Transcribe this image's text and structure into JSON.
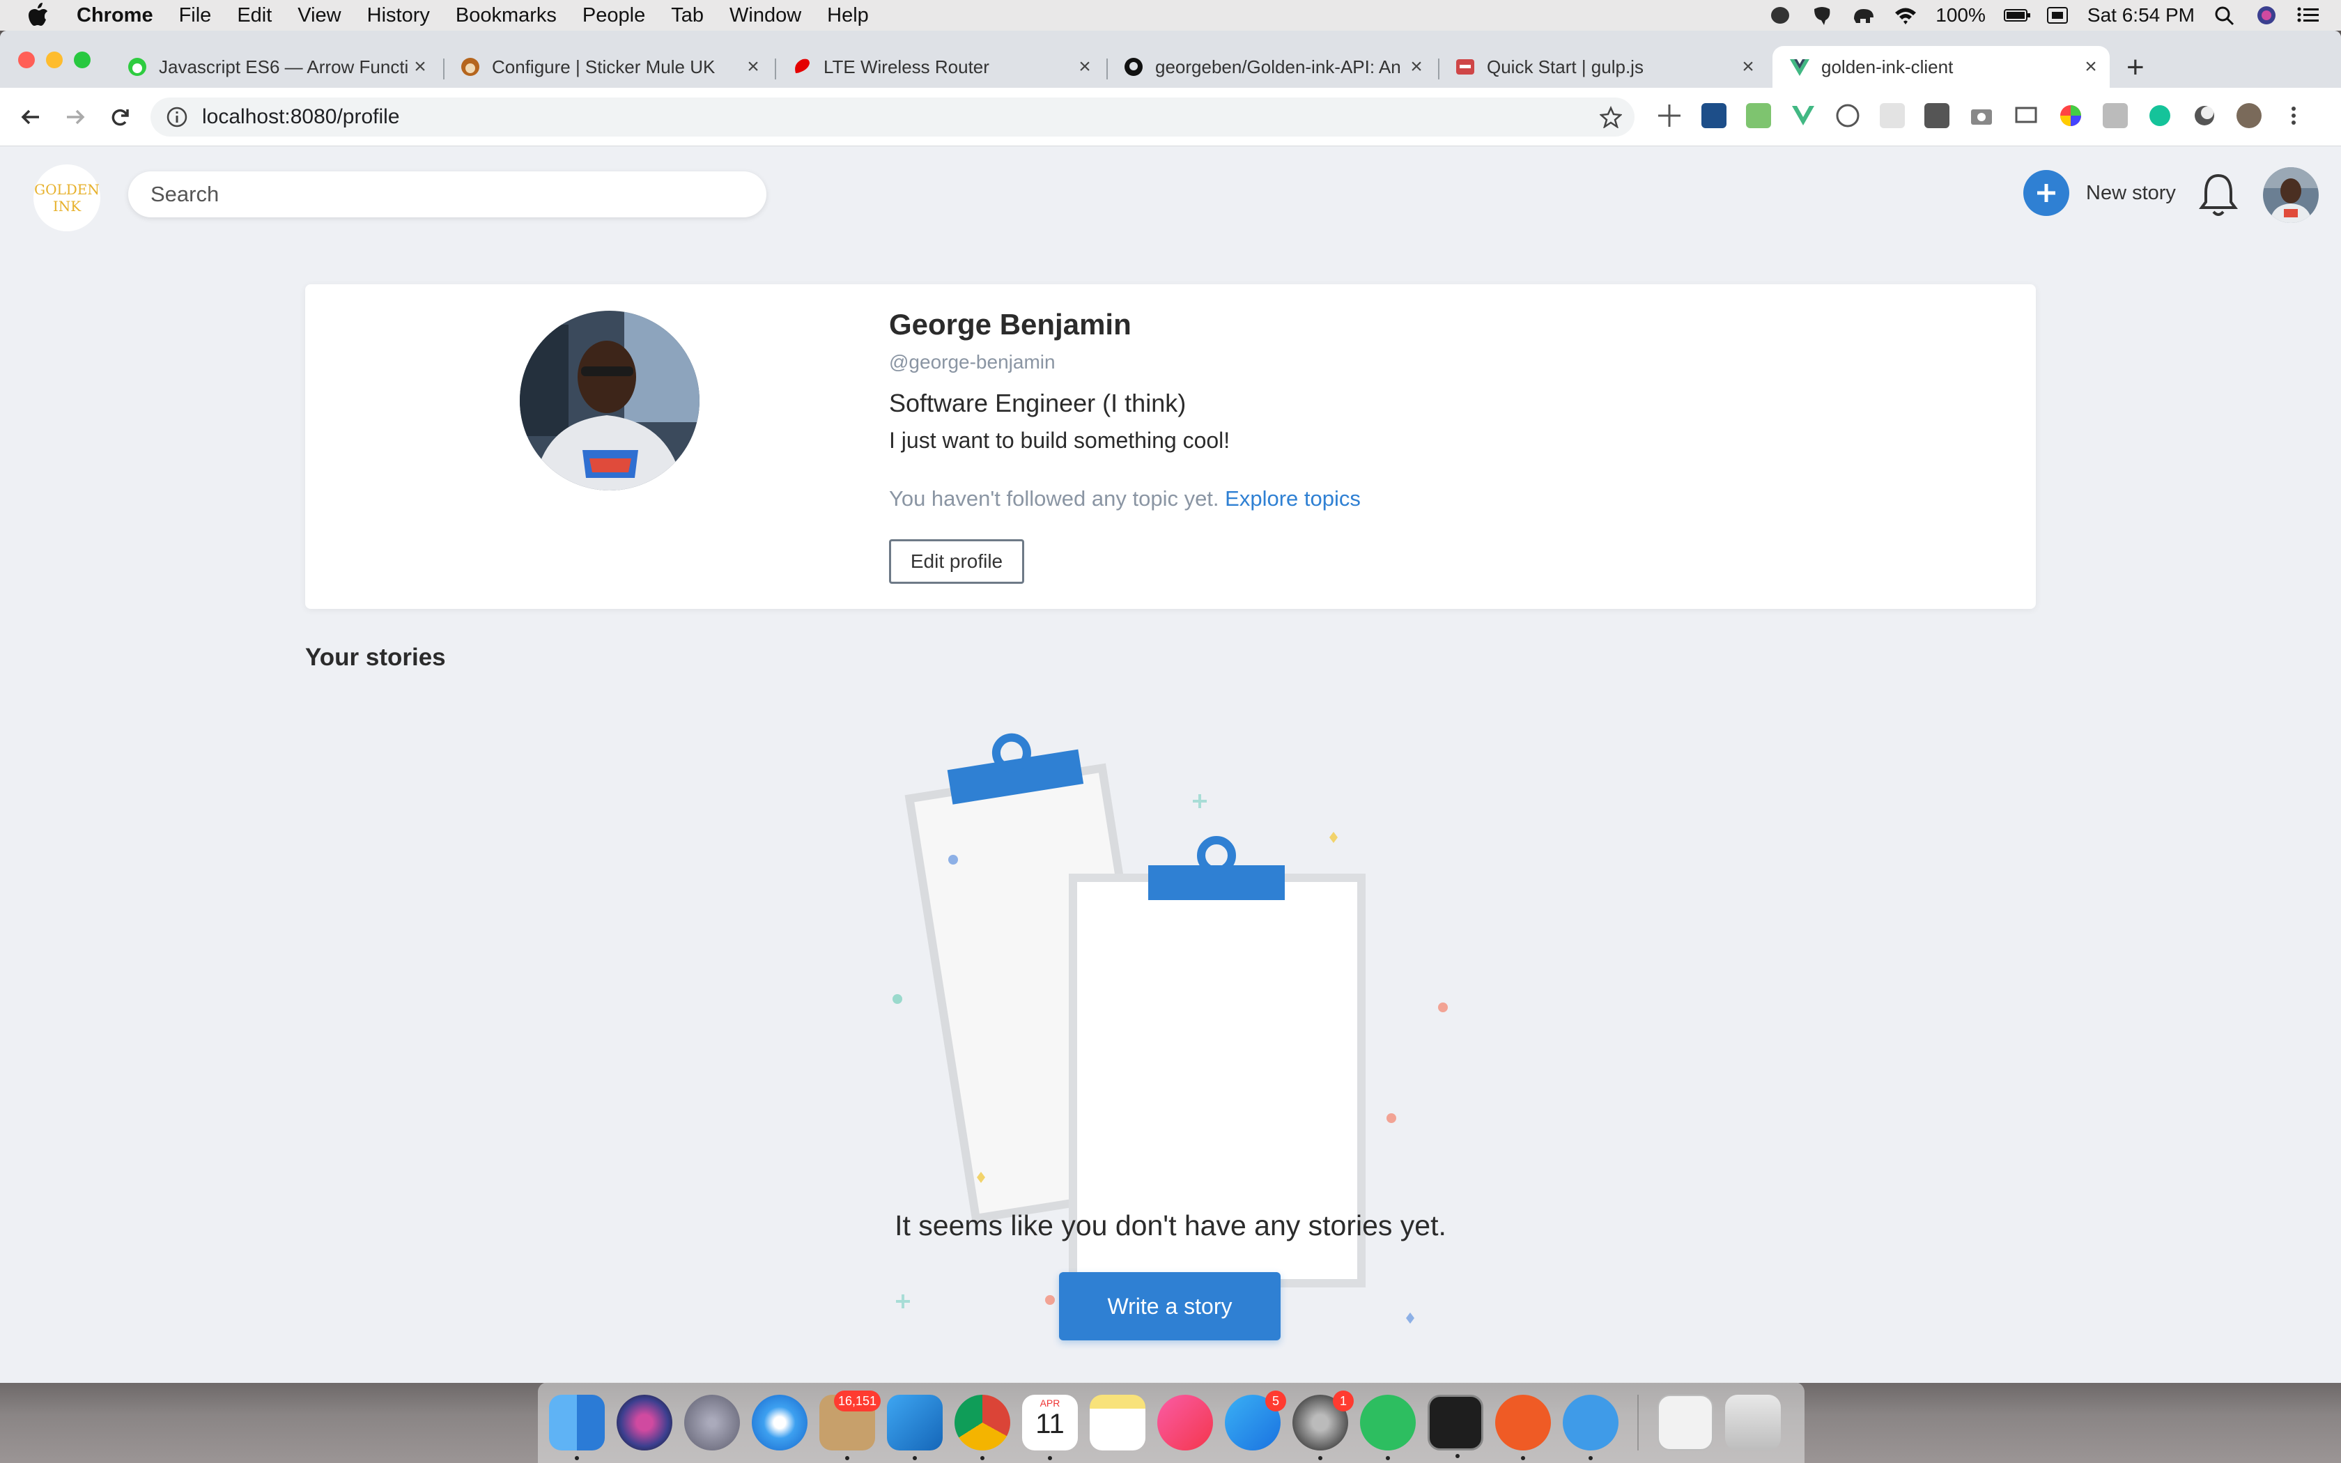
{
  "menubar": {
    "app_name": "Chrome",
    "menus": [
      "File",
      "Edit",
      "View",
      "History",
      "Bookmarks",
      "People",
      "Tab",
      "Window",
      "Help"
    ],
    "battery": "100%",
    "clock": "Sat 6:54 PM"
  },
  "browser": {
    "tabs": [
      {
        "label": "Javascript ES6 — Arrow Functi",
        "favicon": "green-cat-icon"
      },
      {
        "label": "Configure | Sticker Mule UK",
        "favicon": "mule-icon"
      },
      {
        "label": "LTE Wireless Router",
        "favicon": "airtel-icon"
      },
      {
        "label": "georgeben/Golden-ink-API: An",
        "favicon": "github-icon"
      },
      {
        "label": "Quick Start | gulp.js",
        "favicon": "gulp-icon"
      },
      {
        "label": "golden-ink-client",
        "favicon": "vue-icon",
        "active": true
      }
    ],
    "url": "localhost:8080/profile"
  },
  "app": {
    "logo_line1": "GOLDEN",
    "logo_line2": "INK",
    "search_placeholder": "Search",
    "new_story_label": "New story"
  },
  "profile": {
    "name": "George Benjamin",
    "handle": "@george-benjamin",
    "title": "Software Engineer (I think)",
    "bio": "I just want to build something cool!",
    "topics_text": "You haven't followed any topic yet.",
    "topics_link": "Explore topics",
    "edit_label": "Edit profile"
  },
  "stories": {
    "section_title": "Your stories",
    "empty_message": "It seems like you don't have any stories yet.",
    "write_label": "Write a story"
  },
  "dock": {
    "apps": [
      {
        "name": "finder"
      },
      {
        "name": "siri"
      },
      {
        "name": "launchpad"
      },
      {
        "name": "safari"
      },
      {
        "name": "mail",
        "badge": "16,151"
      },
      {
        "name": "vscode"
      },
      {
        "name": "chrome"
      },
      {
        "name": "calendar",
        "month": "APR",
        "day": "11"
      },
      {
        "name": "notes"
      },
      {
        "name": "itunes"
      },
      {
        "name": "app-store",
        "badge": "5"
      },
      {
        "name": "system-preferences",
        "badge": "1"
      },
      {
        "name": "evernote"
      },
      {
        "name": "terminal"
      },
      {
        "name": "postman"
      },
      {
        "name": "tableplus"
      },
      {
        "name": "preview"
      },
      {
        "name": "trash"
      }
    ]
  },
  "colors": {
    "accent": "#2f80d3",
    "page_bg": "#eef0f4",
    "logo_gold": "#e7b12c"
  }
}
